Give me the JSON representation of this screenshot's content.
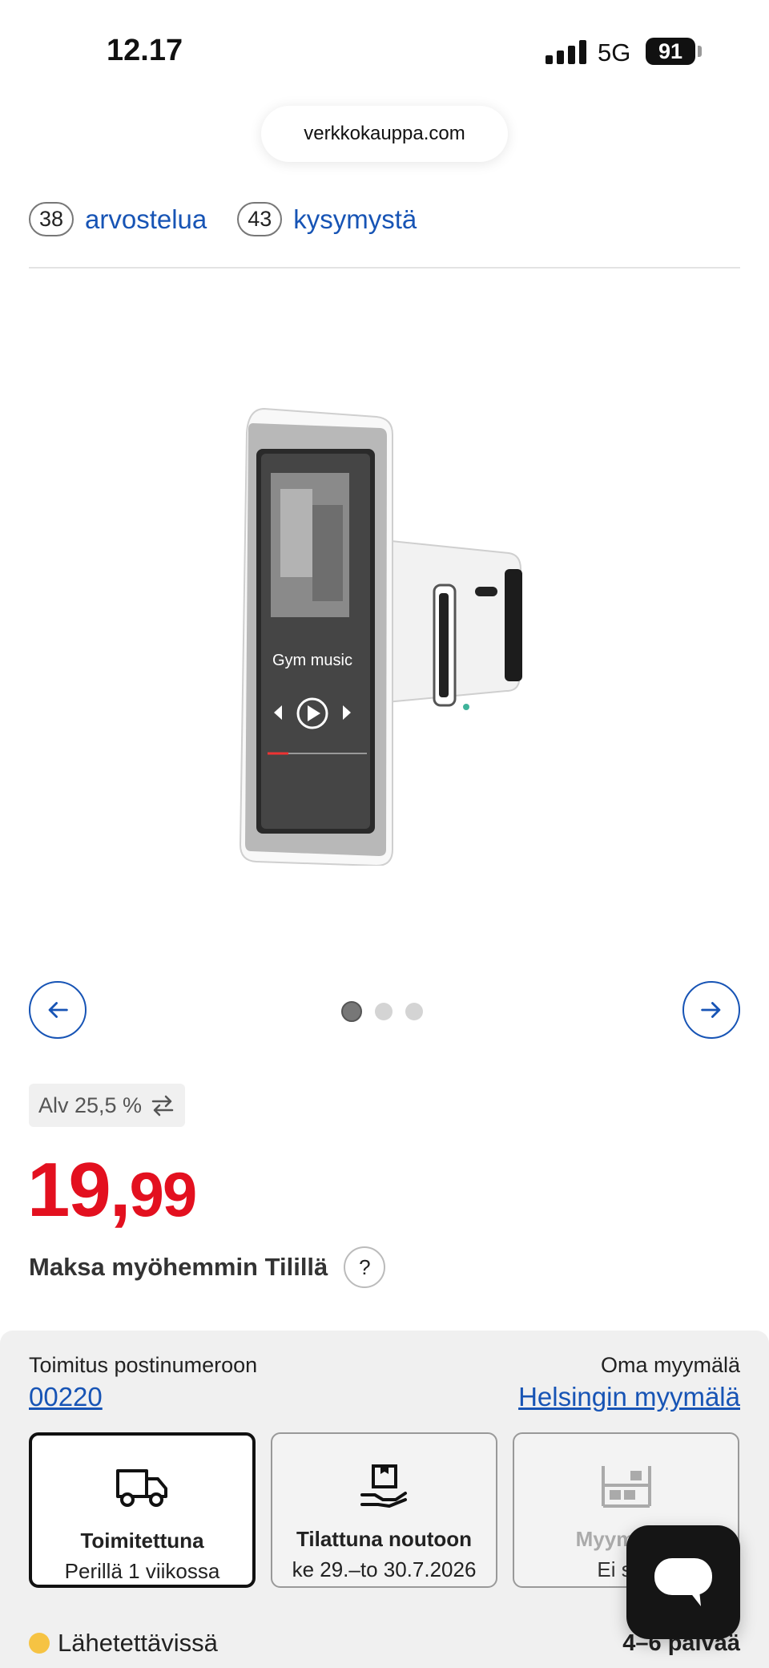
{
  "status_bar": {
    "time": "12.17",
    "network": "5G",
    "battery": "91"
  },
  "browser": {
    "url": "verkkokauppa.com"
  },
  "reviews": {
    "review_count": "38",
    "review_label": "arvostelua",
    "question_count": "43",
    "question_label": "kysymystä"
  },
  "product_image": {
    "screen_text": "Gym music"
  },
  "carousel": {
    "total_images": 3,
    "active_index": 0
  },
  "pricing": {
    "vat_label": "Alv 25,5 %",
    "price_euros": "19,",
    "price_cents": "99",
    "pay_later": "Maksa myöhemmin Tilillä",
    "help_symbol": "?"
  },
  "delivery": {
    "left_label": "Toimitus postinumeroon",
    "postal_code": "00220",
    "right_label": "Oma myymälä",
    "store_name": "Helsingin myymälä",
    "options": [
      {
        "title": "Toimitettuna",
        "subtitle": "Perillä 1 viikossa",
        "icon": "truck-icon",
        "selected": true
      },
      {
        "title": "Tilattuna noutoon",
        "subtitle": "ke 29.–to 30.7.2026",
        "icon": "pickup-hand-icon",
        "selected": false
      },
      {
        "title": "Myymälän",
        "subtitle": "Ei saa",
        "icon": "store-shelf-icon",
        "selected": false
      }
    ],
    "availability": {
      "status": "Lähetettävissä",
      "lead_time": "4–6 päivää",
      "status_color": "#f6c343"
    }
  },
  "colors": {
    "accent_blue": "#1754b5",
    "price_red": "#e3101f"
  }
}
